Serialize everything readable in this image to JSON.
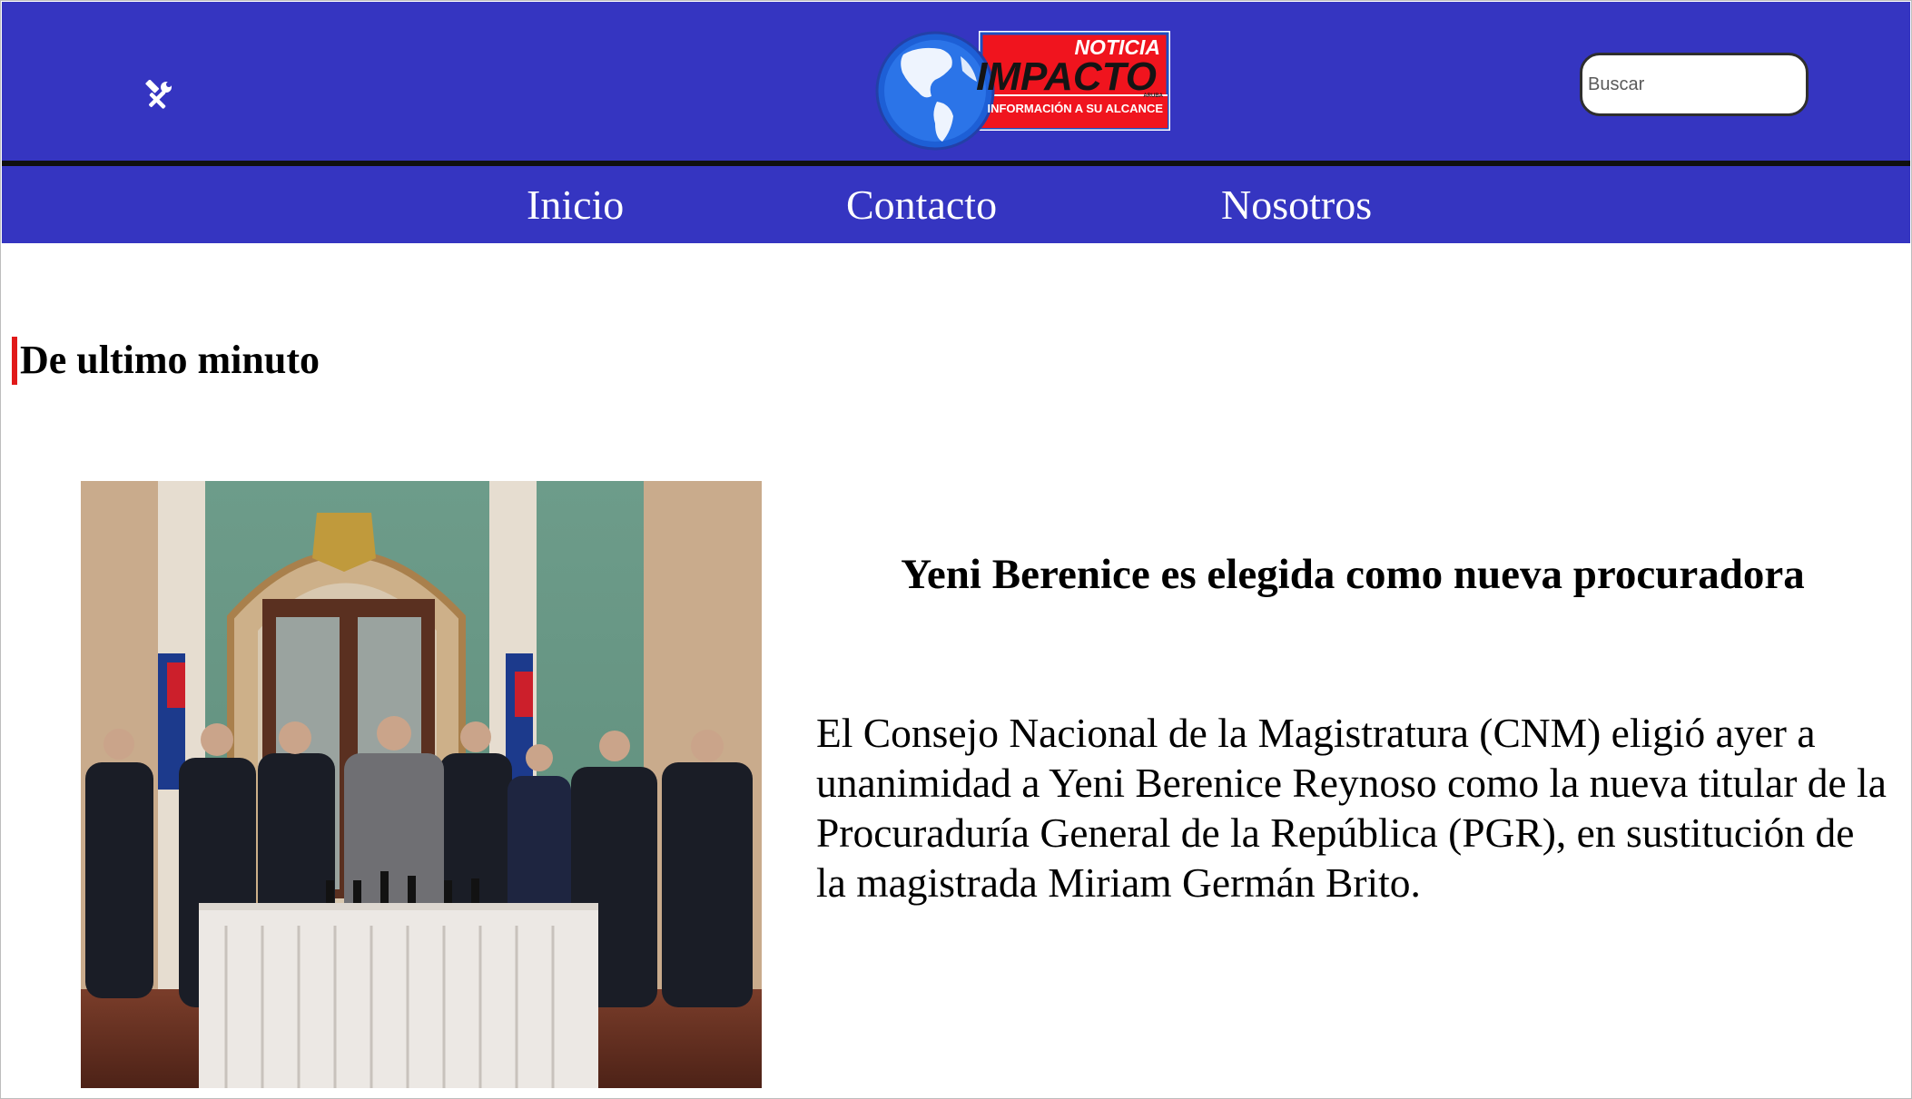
{
  "header": {
    "logo": {
      "top_text": "NOTICIA",
      "main_text": "IMPACTO",
      "small_text": "ARUBA",
      "tagline": "INFORMACIÓN A SU ALCANCE"
    },
    "tools_icon": "tools-icon",
    "search": {
      "placeholder": "Buscar",
      "value": ""
    }
  },
  "nav": {
    "items": [
      {
        "label": "Inicio"
      },
      {
        "label": "Contacto"
      },
      {
        "label": "Nosotros"
      }
    ]
  },
  "section": {
    "title": "De ultimo minuto"
  },
  "article": {
    "title": "Yeni Berenice es elegida como nueva procuradora",
    "body": "El Consejo Nacional de la Magistratura (CNM) eligió ayer a unanimidad a Yeni Berenice Reynoso como la nueva titular de la Procuraduría General de la República (PGR), en sustitución de la magistrada Miriam Germán Brito."
  },
  "colors": {
    "header_bg": "#3535c1",
    "accent_red": "#e11919",
    "logo_red": "#f0141e",
    "globe_blue": "#1d5fd6"
  }
}
